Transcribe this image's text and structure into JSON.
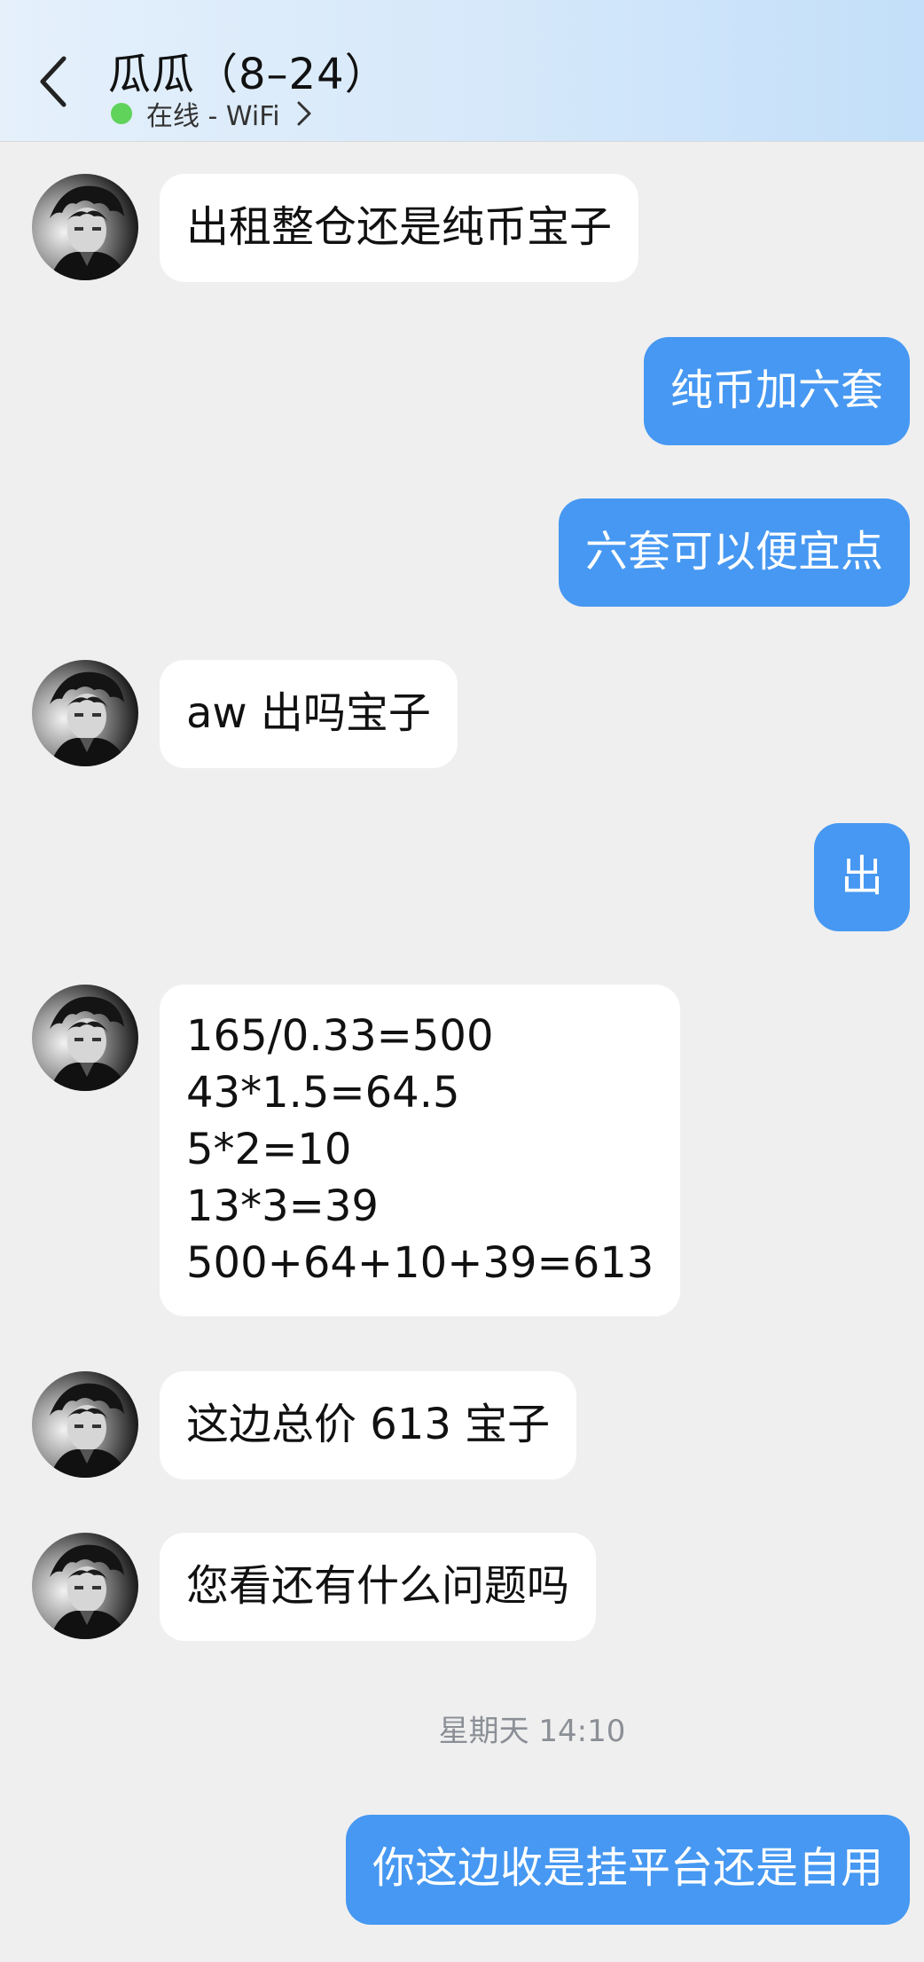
{
  "header": {
    "title": "瓜瓜（8–24）",
    "status_text": "在线 - WiFi",
    "status_color": "#5fd35a",
    "icons": {
      "back": "chevron-left-icon",
      "status_more": "chevron-right-icon"
    }
  },
  "messages": [
    {
      "side": "in",
      "text": "出租整仓还是纯币宝子"
    },
    {
      "side": "out",
      "text": "纯币加六套"
    },
    {
      "side": "out",
      "text": "六套可以便宜点"
    },
    {
      "side": "in",
      "text": "aw 出吗宝子"
    },
    {
      "side": "out",
      "text": "出"
    },
    {
      "side": "in",
      "text": "165/0.33=500\n43*1.5=64.5\n5*2=10\n13*3=39\n500+64+10+39=613"
    },
    {
      "side": "in",
      "text": "这边总价 613 宝子"
    },
    {
      "side": "in",
      "text": "您看还有什么问题吗"
    },
    {
      "side": "out",
      "text": "你这边收是挂平台还是自用"
    }
  ],
  "timestamp": "星期天 14:10",
  "colors": {
    "outgoing_bubble": "#4698f2",
    "incoming_bubble": "#ffffff",
    "background": "#efefef"
  }
}
